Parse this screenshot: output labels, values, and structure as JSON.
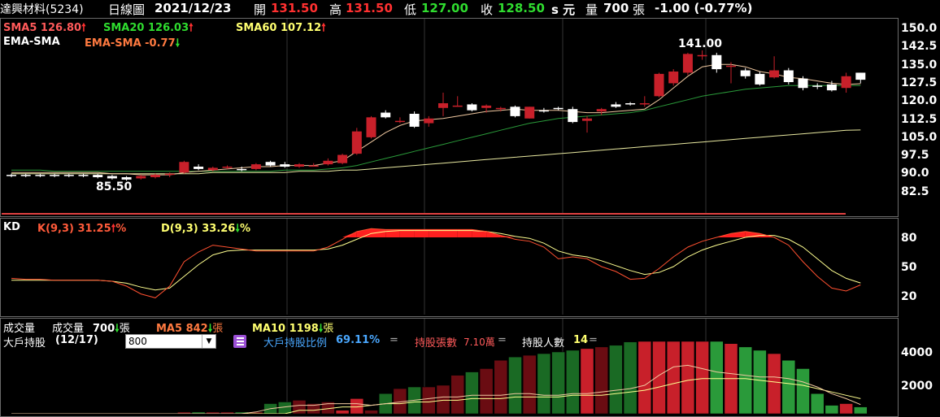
{
  "header": {
    "stock": "達興材料(5234)",
    "period": "日線圖",
    "date": "2021/12/23",
    "open_label": "開",
    "open": "131.50",
    "high_label": "高",
    "high": "131.50",
    "low_label": "低",
    "low": "127.00",
    "close_label": "收",
    "close": "128.50",
    "unit": "s 元",
    "vol_label": "量",
    "volume": "700",
    "vol_unit": "張",
    "change": "-1.00 (-0.77%)"
  },
  "price_panel": {
    "sma5": "SMA5 126.80",
    "sma20": "SMA20 126.03",
    "sma60": "SMA60 107.12",
    "ema_sma_title": "EMA-SMA",
    "ema_sma": "EMA-SMA -0.77",
    "high_mark": "141.00",
    "low_mark": "85.50",
    "axis": [
      "150.0",
      "142.5",
      "135.0",
      "127.5",
      "120.0",
      "112.5",
      "105.0",
      "97.5",
      "90.0",
      "82.5"
    ]
  },
  "kd_panel": {
    "title": "KD",
    "k": "K(9,3) 31.25",
    "d": "D(9,3) 33.26",
    "pct": "%",
    "axis": [
      "80",
      "50",
      "20"
    ]
  },
  "volume_panel": {
    "title": "成交量",
    "vol_label": "成交量",
    "vol": "700",
    "vol_unit": "張",
    "ma5": "MA5 842",
    "ma10": "MA10 1198",
    "holders_title": "大戶持股",
    "holders_date": "(12/17)",
    "select_value": "800",
    "ratio_label": "大戶持股比例",
    "ratio": "69.11%",
    "ratio_eq": "=",
    "shares_label": "持股張數",
    "shares": "7.10萬",
    "shares_eq": "=",
    "people_label": "持股人數",
    "people": "14",
    "people_eq": "=",
    "axis": [
      "4000",
      "2000"
    ]
  },
  "colors": {
    "up": "#c8202a",
    "down": "#ffffff",
    "sma5": "#f0c8a0",
    "sma20": "#2a9a3a",
    "sma60": "#e8e8a0",
    "k": "#ff5030",
    "d": "#ffff90"
  },
  "chart_data": {
    "type": "candlestick",
    "ylim": [
      78,
      152
    ],
    "candles": [
      [
        88.0,
        88.5,
        87.0,
        87.5
      ],
      [
        88.0,
        88.5,
        87.0,
        87.5
      ],
      [
        88.0,
        88.5,
        87.0,
        87.5
      ],
      [
        88.0,
        88.5,
        87.0,
        87.5
      ],
      [
        88.0,
        88.5,
        87.0,
        87.5
      ],
      [
        88.0,
        88.5,
        87.0,
        87.5
      ],
      [
        88.0,
        88.5,
        86.5,
        87.0
      ],
      [
        87.5,
        88.0,
        86.0,
        86.5
      ],
      [
        87.0,
        87.5,
        85.5,
        86.0
      ],
      [
        86.5,
        88.0,
        86.0,
        87.5
      ],
      [
        87.0,
        88.5,
        86.5,
        88.0
      ],
      [
        88.0,
        89.0,
        87.0,
        88.5
      ],
      [
        89.0,
        94.0,
        88.5,
        93.5
      ],
      [
        91.5,
        92.5,
        90.0,
        90.5
      ],
      [
        90.0,
        91.5,
        89.5,
        91.0
      ],
      [
        91.0,
        92.0,
        90.5,
        91.5
      ],
      [
        90.5,
        91.5,
        89.5,
        90.0
      ],
      [
        90.5,
        93.0,
        90.0,
        92.5
      ],
      [
        93.5,
        94.0,
        91.5,
        92.0
      ],
      [
        92.5,
        93.5,
        91.0,
        91.5
      ],
      [
        91.5,
        93.0,
        91.0,
        92.5
      ],
      [
        92.0,
        93.0,
        91.5,
        92.0
      ],
      [
        92.5,
        95.0,
        92.0,
        94.0
      ],
      [
        93.0,
        97.0,
        92.5,
        96.5
      ],
      [
        97.0,
        108.0,
        96.5,
        106.5
      ],
      [
        104.0,
        113.0,
        103.5,
        112.5
      ],
      [
        114.5,
        115.5,
        112.0,
        112.5
      ],
      [
        111.0,
        112.5,
        110.0,
        111.0
      ],
      [
        114.0,
        115.0,
        108.0,
        108.5
      ],
      [
        110.0,
        113.0,
        108.5,
        112.0
      ],
      [
        116.5,
        123.0,
        113.0,
        118.5
      ],
      [
        117.0,
        121.5,
        117.0,
        117.5
      ],
      [
        118.0,
        118.5,
        115.0,
        115.5
      ],
      [
        116.5,
        118.0,
        114.5,
        117.5
      ],
      [
        116.5,
        117.0,
        115.0,
        116.5
      ],
      [
        117.0,
        117.5,
        112.5,
        113.0
      ],
      [
        112.0,
        117.0,
        112.0,
        117.0
      ],
      [
        115.5,
        116.5,
        114.5,
        115.0
      ],
      [
        116.5,
        117.0,
        115.5,
        116.0
      ],
      [
        116.0,
        117.0,
        110.0,
        110.5
      ],
      [
        111.0,
        113.0,
        106.0,
        112.0
      ],
      [
        115.0,
        116.5,
        113.5,
        116.0
      ],
      [
        118.0,
        119.0,
        116.5,
        117.0
      ],
      [
        118.5,
        119.0,
        117.5,
        118.0
      ],
      [
        118.0,
        121.5,
        117.0,
        118.5
      ],
      [
        121.5,
        131.5,
        121.0,
        131.0
      ],
      [
        127.0,
        133.0,
        126.0,
        132.0
      ],
      [
        131.5,
        140.0,
        130.5,
        139.5
      ],
      [
        138.5,
        141.0,
        137.0,
        139.0
      ],
      [
        139.0,
        140.0,
        131.5,
        133.0
      ],
      [
        134.0,
        136.0,
        127.0,
        134.5
      ],
      [
        132.5,
        133.5,
        129.0,
        130.0
      ],
      [
        131.0,
        132.0,
        126.0,
        126.5
      ],
      [
        129.5,
        138.5,
        129.0,
        132.5
      ],
      [
        132.5,
        133.5,
        126.5,
        127.5
      ],
      [
        129.0,
        130.0,
        124.0,
        125.0
      ],
      [
        126.0,
        127.0,
        124.5,
        125.5
      ],
      [
        126.5,
        128.0,
        123.5,
        124.0
      ],
      [
        125.0,
        131.5,
        123.0,
        130.0
      ],
      [
        131.5,
        131.5,
        127.0,
        128.5
      ]
    ],
    "sma5": [
      89,
      89,
      89,
      89,
      89,
      89,
      89,
      88.5,
      88.5,
      88,
      88,
      88,
      89,
      89.5,
      90,
      90.5,
      91,
      91.5,
      91.5,
      92,
      92,
      92,
      93,
      94,
      98,
      102,
      106,
      109,
      111,
      111.5,
      112,
      113,
      114,
      115,
      115.5,
      116,
      115.5,
      115.5,
      115.5,
      115,
      114.5,
      114.5,
      115,
      115.5,
      116,
      120,
      125,
      130,
      134,
      135,
      135,
      134,
      132,
      131,
      129.5,
      129,
      128,
      127,
      126.5,
      126.8
    ],
    "sma20": [
      90,
      90,
      90,
      89.5,
      89.5,
      89.5,
      89.5,
      89.5,
      89.5,
      89.5,
      89.5,
      89.5,
      89.5,
      89.5,
      89.5,
      89.5,
      89.5,
      89.5,
      89.5,
      90,
      90,
      90,
      90.5,
      91,
      92,
      93.5,
      95,
      96.5,
      98,
      99.5,
      101,
      102.5,
      104,
      105.5,
      107,
      108.5,
      110,
      111,
      112,
      112.5,
      113,
      113.5,
      114,
      114.5,
      115.5,
      117,
      118.5,
      120,
      121.5,
      122.5,
      123.5,
      124.5,
      125,
      125.5,
      126,
      126,
      126,
      126,
      126,
      126.03
    ],
    "sma60": [
      88.5,
      88.5,
      88.5,
      88.5,
      88.5,
      88.5,
      88.5,
      88.5,
      88.5,
      88.5,
      88.5,
      88.5,
      88.5,
      88.5,
      89,
      89,
      89,
      89,
      89,
      89,
      89.5,
      89.5,
      89.5,
      90,
      90,
      90.5,
      91,
      91.5,
      92,
      92.5,
      93,
      93.5,
      94,
      94.5,
      95,
      95.5,
      96,
      96.5,
      97,
      97.5,
      98,
      98.5,
      99,
      99.5,
      100,
      100.5,
      101,
      101.5,
      102,
      102.5,
      103,
      103.5,
      104,
      104.5,
      105,
      105.5,
      106,
      106.5,
      107,
      107.12
    ],
    "k": [
      38,
      37,
      37,
      36,
      36,
      36,
      36,
      35,
      30,
      22,
      18,
      30,
      55,
      65,
      72,
      70,
      68,
      66,
      66,
      66,
      66,
      66,
      70,
      78,
      86,
      89,
      88,
      88,
      88,
      88,
      88,
      88,
      88,
      86,
      82,
      78,
      76,
      70,
      58,
      60,
      58,
      50,
      45,
      37,
      38,
      48,
      60,
      70,
      76,
      80,
      84,
      86,
      84,
      80,
      72,
      55,
      40,
      28,
      25,
      31.25
    ],
    "d": [
      36,
      36,
      36,
      36,
      36,
      36,
      36,
      35,
      33,
      29,
      26,
      28,
      40,
      52,
      62,
      66,
      67,
      67,
      67,
      67,
      67,
      67,
      68,
      72,
      78,
      84,
      86,
      87,
      87,
      87,
      87,
      87,
      87,
      86,
      84,
      81,
      79,
      74,
      66,
      62,
      60,
      56,
      51,
      46,
      42,
      44,
      50,
      60,
      67,
      72,
      76,
      80,
      82,
      82,
      78,
      70,
      58,
      46,
      38,
      33.26
    ],
    "volume": [
      0,
      0,
      0,
      0,
      0,
      0,
      0,
      0,
      0,
      0,
      0,
      0,
      400,
      400,
      400,
      400,
      400,
      400,
      900,
      1000,
      1100,
      900,
      1000,
      500,
      1200,
      500,
      1500,
      1800,
      1900,
      1900,
      2000,
      2600,
      2800,
      3000,
      3500,
      3700,
      3800,
      3900,
      4000,
      4100,
      4200,
      4300,
      4400,
      4600,
      4700,
      4800,
      4900,
      5000,
      4900,
      4700,
      4500,
      4300,
      4100,
      3900,
      3500,
      3000,
      1500,
      800,
      900,
      700
    ],
    "volume_ma5": [
      0,
      0,
      0,
      0,
      0,
      0,
      0,
      0,
      0,
      0,
      0,
      0,
      0,
      0,
      0,
      0,
      300,
      400,
      600,
      700,
      800,
      800,
      900,
      900,
      900,
      800,
      900,
      1000,
      1100,
      1200,
      1300,
      1300,
      1400,
      1400,
      1400,
      1500,
      1500,
      1400,
      1400,
      1500,
      1500,
      1600,
      1700,
      1800,
      2000,
      2600,
      3100,
      3200,
      3000,
      2800,
      2700,
      2600,
      2500,
      2500,
      2400,
      2200,
      1900,
      1500,
      1200,
      842
    ],
    "volume_ma10": [
      0,
      0,
      0,
      0,
      0,
      0,
      0,
      0,
      0,
      0,
      0,
      0,
      0,
      0,
      0,
      0,
      0,
      0,
      0,
      0,
      500,
      500,
      600,
      700,
      700,
      800,
      900,
      900,
      1000,
      1000,
      1100,
      1100,
      1200,
      1200,
      1200,
      1300,
      1300,
      1300,
      1300,
      1400,
      1400,
      1400,
      1500,
      1600,
      1700,
      1900,
      2100,
      2300,
      2400,
      2400,
      2400,
      2400,
      2300,
      2200,
      2100,
      2000,
      1800,
      1600,
      1400,
      1198
    ]
  }
}
